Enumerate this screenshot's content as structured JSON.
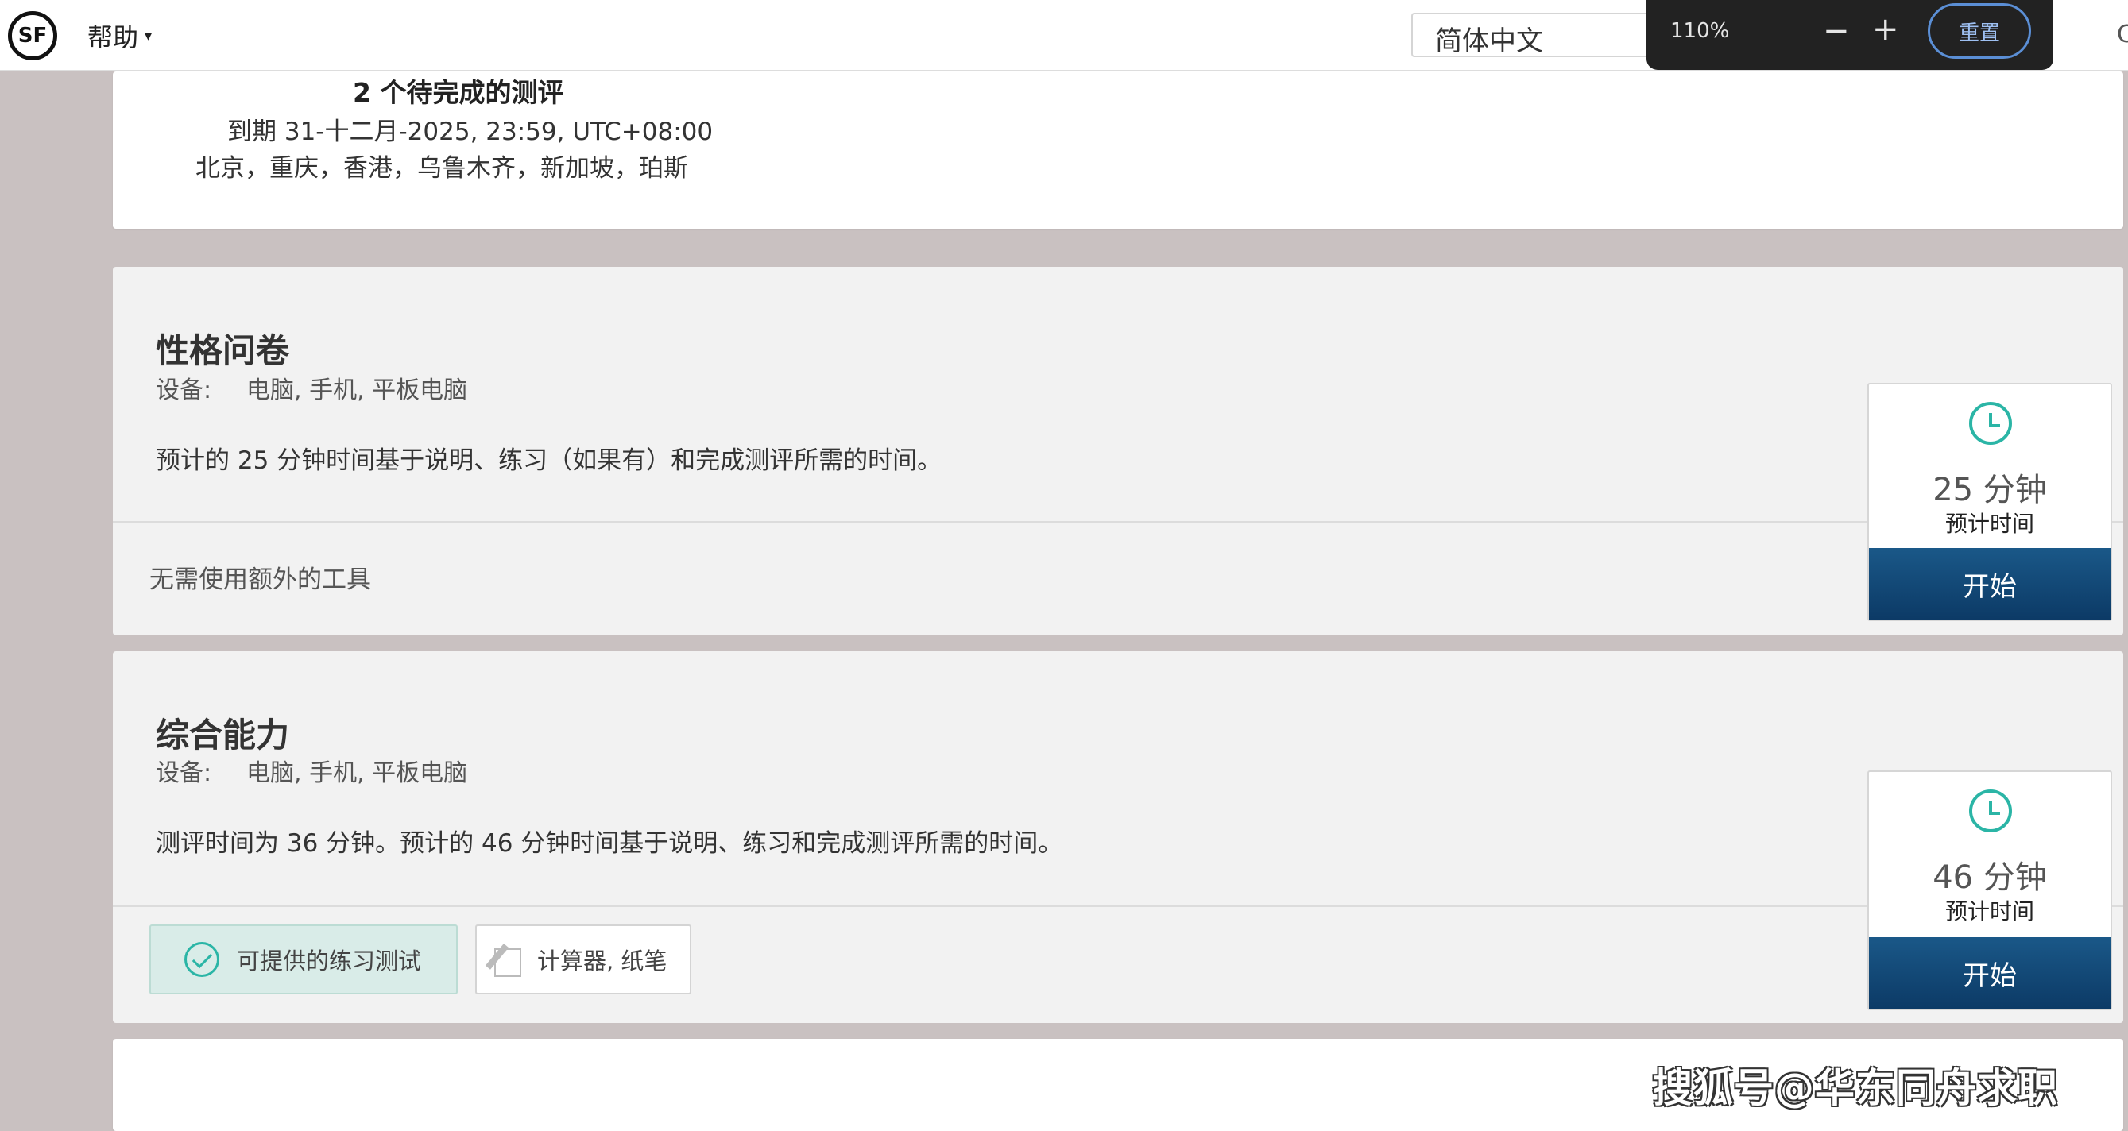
{
  "header": {
    "logo_text": "SF",
    "help_label": "帮助",
    "language": "简体中文",
    "edge_char": "C"
  },
  "zoom": {
    "level": "110%",
    "minus": "−",
    "plus": "+",
    "reset_label": "重置"
  },
  "summary": {
    "pending": "2 个待完成的测评",
    "due": "到期 31-十二月-2025, 23:59, UTC+08:00",
    "cities": "北京，重庆，香港，乌鲁木齐，新加坡，珀斯"
  },
  "assessments": [
    {
      "title": "性格问卷",
      "device_label": "设备:",
      "devices": "电脑, 手机, 平板电脑",
      "description": "预计的 25 分钟时间基于说明、练习（如果有）和完成测评所需的时间。",
      "tools": "无需使用额外的工具",
      "minutes": "25 分钟",
      "time_label": "预计时间",
      "start_label": "开始"
    },
    {
      "title": "综合能力",
      "device_label": "设备:",
      "devices": "电脑, 手机, 平板电脑",
      "description": "测评时间为 36 分钟。预计的 46 分钟时间基于说明、练习和完成测评所需的时间。",
      "practice_label": "可提供的练习测试",
      "tools_label": "计算器, 纸笔",
      "minutes": "46 分钟",
      "time_label": "预计时间",
      "start_label": "开始"
    }
  ],
  "watermark": "搜狐号@华东同舟求职",
  "icons": [
    "logo-icon",
    "caret-down-icon",
    "minus-icon",
    "plus-icon",
    "clock-icon",
    "check-circle-icon",
    "pencil-icon"
  ],
  "colors": {
    "teal_accent": "#2bb5a6",
    "start_button": "#0f4472",
    "page_background": "#c9c1c1",
    "zoom_popup": "#222222"
  }
}
